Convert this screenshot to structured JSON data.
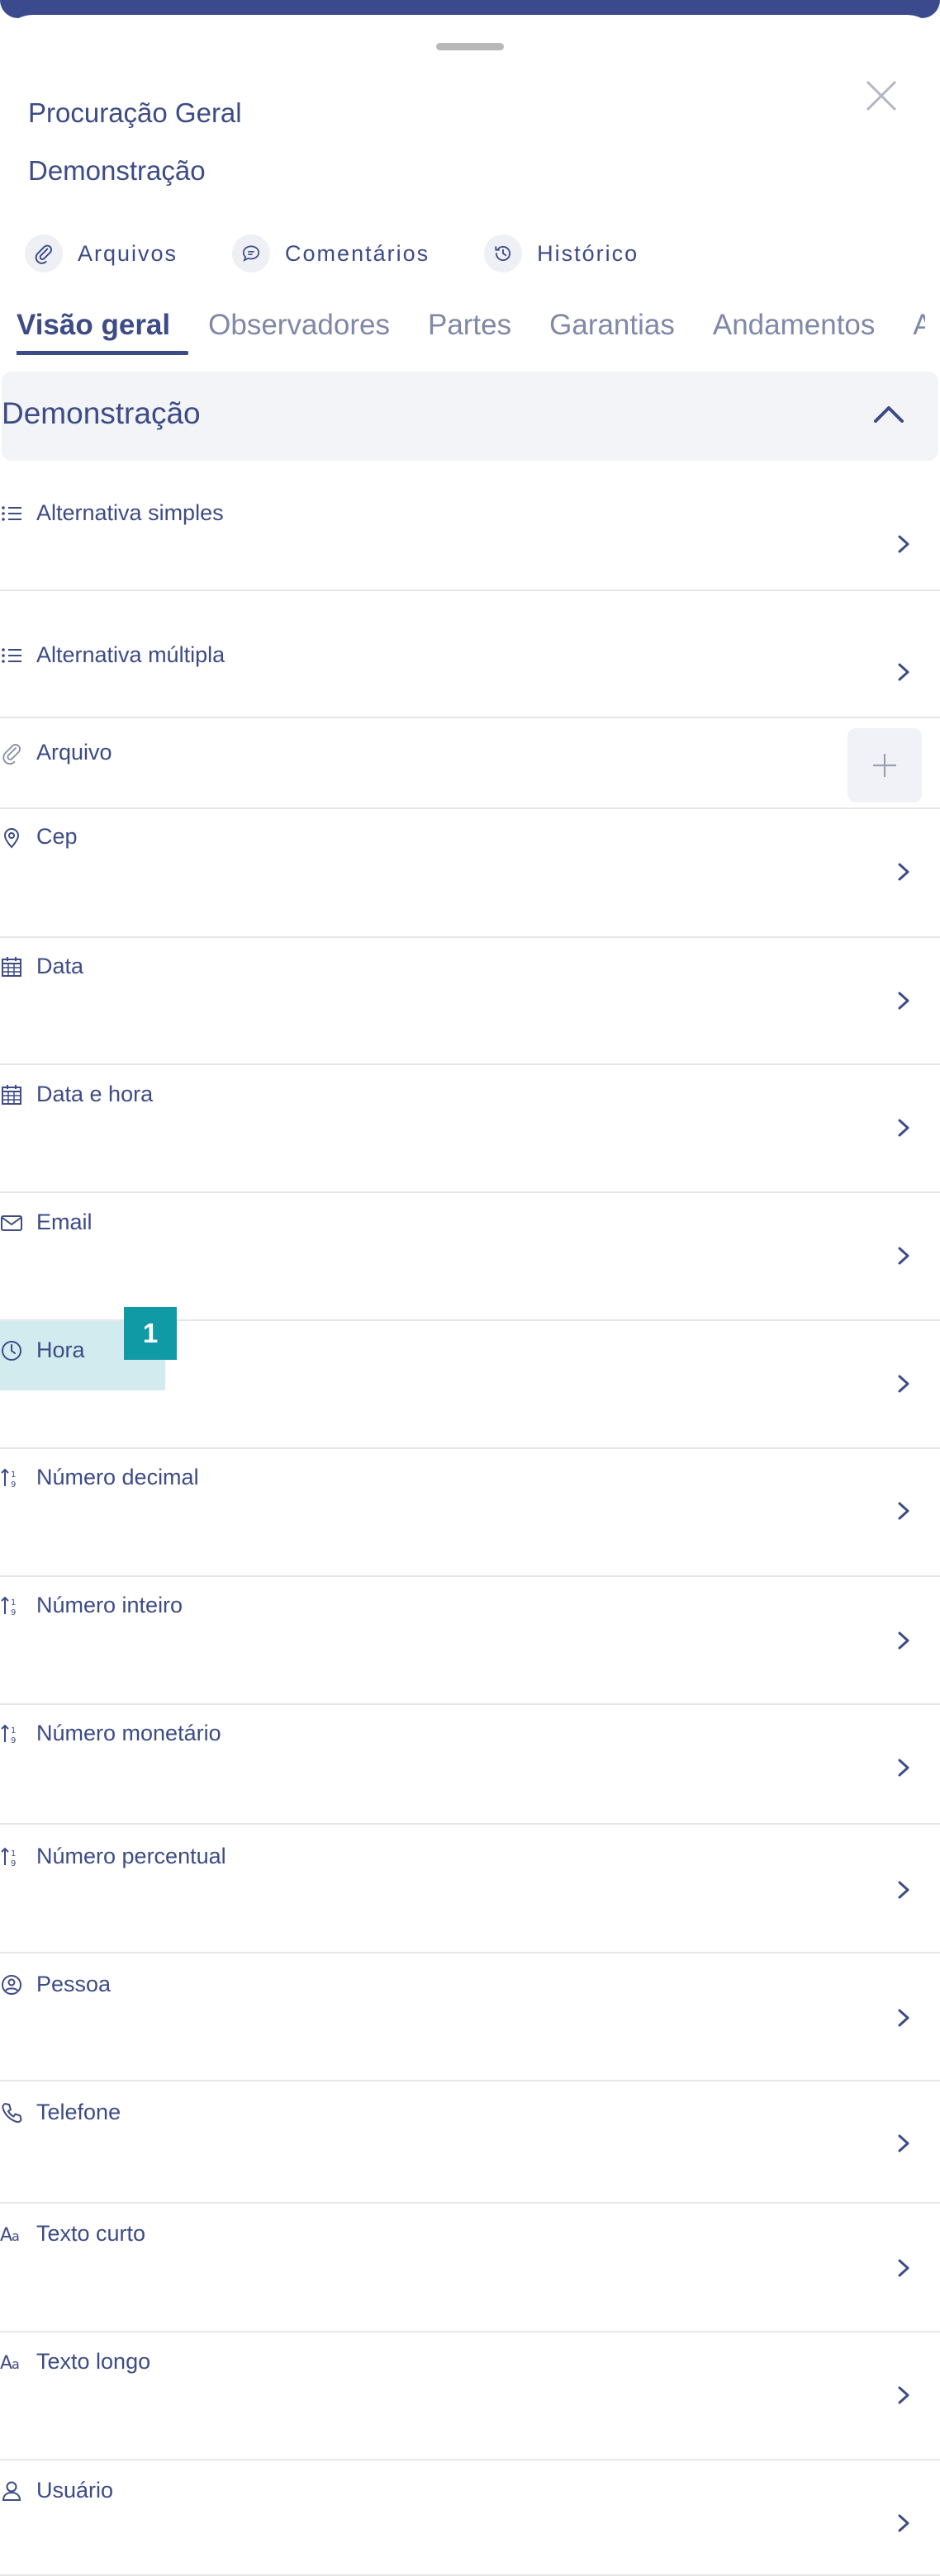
{
  "header": {
    "title": "Procuração Geral",
    "subtitle": "Demonstração"
  },
  "actions": [
    {
      "label": "Arquivos",
      "icon": "paperclip-icon"
    },
    {
      "label": "Comentários",
      "icon": "comment-icon"
    },
    {
      "label": "Histórico",
      "icon": "history-icon"
    }
  ],
  "tabs": [
    "Visão geral",
    "Observadores",
    "Partes",
    "Garantias",
    "Andamentos",
    "A"
  ],
  "active_tab": "Visão geral",
  "section": {
    "title": "Demonstração",
    "expanded": true
  },
  "fields": [
    {
      "label": "Alternativa simples",
      "icon": "list-icon"
    },
    {
      "label": "Alternativa múltipla",
      "icon": "list-icon"
    },
    {
      "label": "Arquivo",
      "icon": "paperclip-icon"
    },
    {
      "label": "Cep",
      "icon": "location-pin-icon"
    },
    {
      "label": "Data",
      "icon": "calendar-icon"
    },
    {
      "label": "Data e hora",
      "icon": "calendar-icon"
    },
    {
      "label": "Email",
      "icon": "envelope-icon"
    },
    {
      "label": "Hora",
      "icon": "clock-icon"
    },
    {
      "label": "Número decimal",
      "icon": "number-sort-icon"
    },
    {
      "label": "Número inteiro",
      "icon": "number-sort-icon"
    },
    {
      "label": "Número monetário",
      "icon": "number-sort-icon"
    },
    {
      "label": "Número percentual",
      "icon": "number-sort-icon"
    },
    {
      "label": "Pessoa",
      "icon": "person-circle-icon"
    },
    {
      "label": "Telefone",
      "icon": "phone-icon"
    },
    {
      "label": "Texto curto",
      "icon": "text-icon"
    },
    {
      "label": "Texto longo",
      "icon": "text-icon"
    },
    {
      "label": "Usuário",
      "icon": "user-icon"
    }
  ],
  "annotation_badge": "1",
  "colors": {
    "primary": "#3d4b86",
    "muted": "#8088a8",
    "section_bg": "#f3f4f8",
    "highlight": "#d2ebee",
    "badge": "#0f9aa6"
  }
}
